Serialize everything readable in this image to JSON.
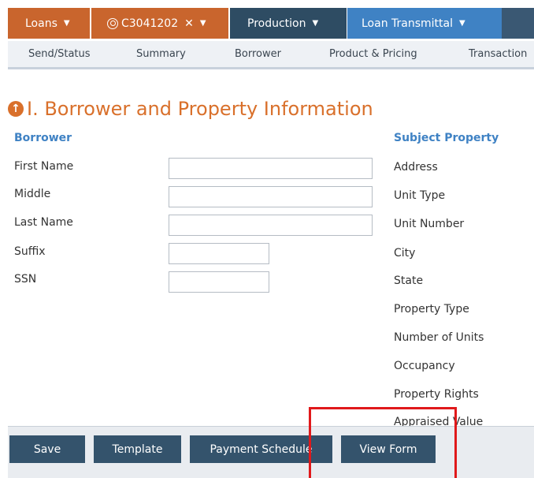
{
  "tabs": {
    "loans": "Loans",
    "client": "C3041202",
    "production": "Production",
    "transmittal": "Loan Transmittal"
  },
  "subnav": [
    "Send/Status",
    "Summary",
    "Borrower",
    "Product & Pricing",
    "Transaction"
  ],
  "section": {
    "title": "I. Borrower and Property Information"
  },
  "borrower": {
    "heading": "Borrower",
    "fields": [
      "First Name",
      "Middle",
      "Last Name",
      "Suffix",
      "SSN"
    ]
  },
  "property": {
    "heading": "Subject Property",
    "fields": [
      "Address",
      "Unit Type",
      "Unit Number",
      "City",
      "State",
      "Property Type",
      "Number of Units",
      "Occupancy",
      "Property Rights",
      "Appraised Value"
    ]
  },
  "buttons": {
    "save": "Save",
    "template": "Template",
    "payment_schedule": "Payment Schedule",
    "view_form": "View Form"
  },
  "colors": {
    "accent_orange": "#c9652d",
    "nav_dark": "#2e4c63",
    "nav_blue": "#3f82c4",
    "highlight_red": "#e0191b"
  }
}
